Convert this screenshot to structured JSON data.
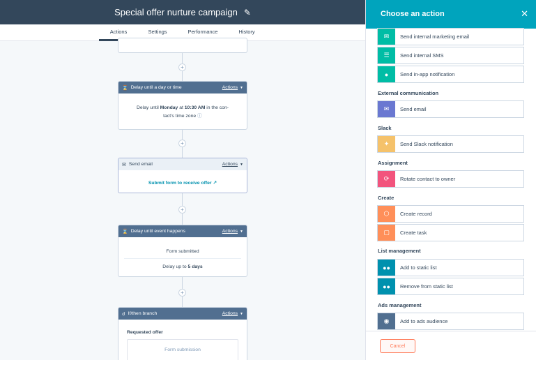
{
  "header": {
    "title": "Special offer nurture campaign",
    "tabs": [
      {
        "label": "Actions",
        "active": true
      },
      {
        "label": "Settings",
        "active": false
      },
      {
        "label": "Performance",
        "active": false
      },
      {
        "label": "History",
        "active": false
      }
    ]
  },
  "workflow": {
    "cards": [
      {
        "header": "Delay until a day or time",
        "actions": "Actions",
        "body_prefix": "Delay until",
        "body_day": "Monday",
        "body_at": "at",
        "body_time": "10:30 AM",
        "body_suffix_1": "in the con-",
        "body_suffix_2": "tact's time zone"
      },
      {
        "header": "Send email",
        "actions": "Actions",
        "link": "Submit form to receive offer"
      },
      {
        "header": "Delay until event happens",
        "actions": "Actions",
        "line1": "Form submitted",
        "line2_prefix": "Delay up to",
        "line2_value": "5 days"
      },
      {
        "header": "If/then branch",
        "actions": "Actions",
        "branch_label": "Requested offer",
        "branch_option": "Form submission"
      }
    ]
  },
  "panel": {
    "title": "Choose an action",
    "sections": [
      {
        "label": "External communication"
      },
      {
        "label": "Slack"
      },
      {
        "label": "Assignment"
      },
      {
        "label": "Create"
      },
      {
        "label": "List management"
      },
      {
        "label": "Ads management"
      }
    ],
    "items": [
      {
        "label": "Send internal marketing email",
        "icon": "mail-icon",
        "color": "#00bda5"
      },
      {
        "label": "Send internal SMS",
        "icon": "chat-icon",
        "color": "#00bda5"
      },
      {
        "label": "Send in-app notification",
        "icon": "bell-icon",
        "color": "#00bda5"
      },
      {
        "label": "Send email",
        "icon": "mail-icon",
        "color": "#6a78d1"
      },
      {
        "label": "Send Slack notification",
        "icon": "slack-icon",
        "color": "#f5c26b"
      },
      {
        "label": "Rotate contact to owner",
        "icon": "rotate-owner-icon",
        "color": "#f2547d"
      },
      {
        "label": "Create record",
        "icon": "cube-icon",
        "color": "#ff8f59"
      },
      {
        "label": "Create task",
        "icon": "task-icon",
        "color": "#ff8f59"
      },
      {
        "label": "Add to static list",
        "icon": "people-icon",
        "color": "#0091ae"
      },
      {
        "label": "Remove from static list",
        "icon": "people-icon",
        "color": "#0091ae"
      },
      {
        "label": "Add to ads audience",
        "icon": "target-icon",
        "color": "#516f90"
      }
    ],
    "cancel_label": "Cancel"
  }
}
